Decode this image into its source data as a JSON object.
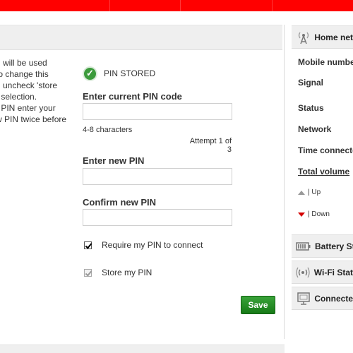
{
  "intro_text": [
    "d will be used",
    "to change this",
    "d uncheck 'store",
    "r selection.",
    "r PIN enter your",
    "w PIN twice before"
  ],
  "pin_status": {
    "icon": "check-icon",
    "text": "PIN STORED"
  },
  "current_pin": {
    "label": "Enter current PIN code",
    "value": "",
    "hint": "4-8 characters",
    "attempt": "Attempt 1 of 3"
  },
  "new_pin": {
    "label": "Enter new PIN",
    "value": ""
  },
  "confirm_pin": {
    "label": "Confirm new PIN",
    "value": ""
  },
  "require_pin": {
    "label": "Require my PIN to connect",
    "checked": true
  },
  "store_pin": {
    "label": "Store my PIN",
    "checked": true,
    "disabled": true
  },
  "save_label": "Save",
  "sidebar": {
    "home_network": {
      "title": "Home net",
      "icon": "antenna-icon",
      "rows": [
        "Mobile numbe",
        "Signal",
        "Status",
        "Network",
        "Time connecte",
        "Total volume"
      ],
      "up_label": "| Up",
      "down_label": "| Down"
    },
    "battery": {
      "title": "Battery St",
      "icon": "battery-icon"
    },
    "wifi": {
      "title": "Wi-Fi Stat",
      "icon": "wifi-icon"
    },
    "connected": {
      "title": "Connecte",
      "icon": "monitor-icon"
    }
  },
  "colors": {
    "brand_red": "#ff0000",
    "save_green": "#2a8f2a",
    "status_green": "#3c9b3c",
    "down_red": "#d40000"
  }
}
